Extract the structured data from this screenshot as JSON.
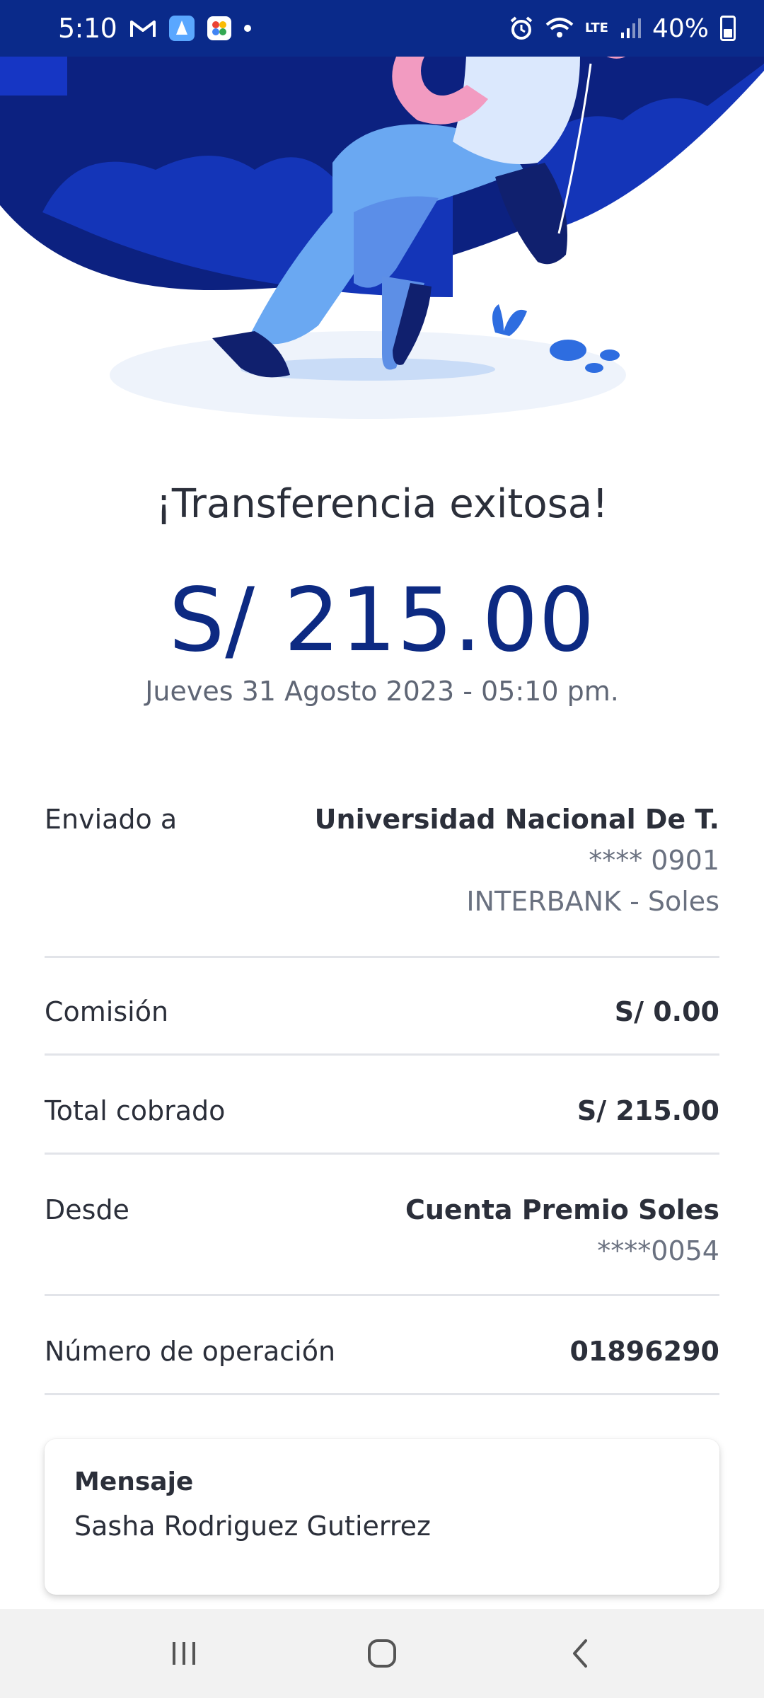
{
  "status_bar": {
    "time": "5:10",
    "battery": "40%",
    "network": "LTE"
  },
  "result": {
    "title": "¡Transferencia exitosa!",
    "amount": "S/ 215.00",
    "datetime": "Jueves 31 Agosto 2023 - 05:10 pm."
  },
  "details": {
    "sent_to": {
      "label": "Enviado a",
      "name": "Universidad Nacional De T.",
      "account": "**** 0901",
      "bank": "INTERBANK - Soles"
    },
    "commission": {
      "label": "Comisión",
      "value": "S/ 0.00"
    },
    "total": {
      "label": "Total cobrado",
      "value": "S/ 215.00"
    },
    "from": {
      "label": "Desde",
      "account_name": "Cuenta Premio Soles",
      "account_number": "****0054"
    },
    "operation": {
      "label": "Número de operación",
      "value": "01896290"
    }
  },
  "message": {
    "title": "Mensaje",
    "text": "Sasha Rodriguez Gutierrez"
  },
  "icons": {
    "status": [
      "gmail-icon",
      "app-icon",
      "photos-icon",
      "alarm-icon",
      "wifi-icon",
      "lte-icon",
      "signal-icon",
      "battery-icon"
    ],
    "nav": [
      "recent-apps-icon",
      "home-icon",
      "back-icon"
    ]
  },
  "colors": {
    "brand_blue": "#0d2a82",
    "status_bar": "#0a2a8a",
    "text": "#2b2f3a",
    "muted": "#6a7180"
  }
}
